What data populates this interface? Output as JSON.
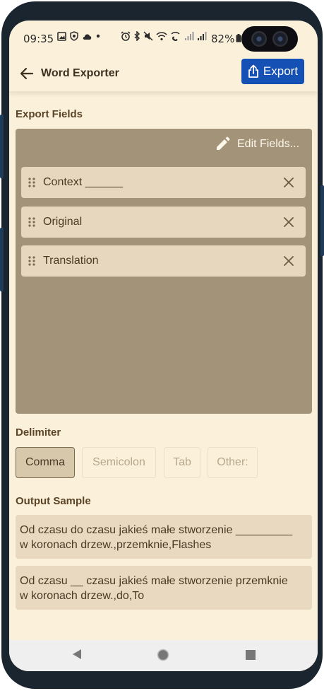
{
  "status_bar": {
    "time": "09:35",
    "battery": "82%"
  },
  "app_bar": {
    "title": "Word Exporter",
    "export_label": "Export"
  },
  "export_fields": {
    "section_label": "Export Fields",
    "edit_fields_label": "Edit Fields...",
    "items": [
      {
        "label": "Context ______"
      },
      {
        "label": "Original"
      },
      {
        "label": "Translation"
      }
    ]
  },
  "delimiter": {
    "section_label": "Delimiter",
    "options": [
      {
        "label": "Comma",
        "selected": true
      },
      {
        "label": "Semicolon",
        "selected": false
      },
      {
        "label": "Tab",
        "selected": false
      },
      {
        "label": "Other:",
        "selected": false
      }
    ]
  },
  "output_sample": {
    "section_label": "Output Sample",
    "rows": [
      "Od czasu do czasu jakieś małe stworzenie _________\nw koronach drzew.,przemknie,Flashes",
      "Od czasu __ czasu jakieś małe stworzenie przemknie\nw koronach drzew.,do,To"
    ]
  },
  "colors": {
    "background": "#fbf0d9",
    "accent": "#1550b5",
    "panel": "#a39378",
    "field_chip": "#e6d7be",
    "heading_text": "#5b4427"
  },
  "icons": {
    "back": "arrow-left-icon",
    "export": "share-upload-icon",
    "edit": "pencil-icon",
    "drag": "drag-handle-icon",
    "remove": "close-icon",
    "nav_back": "triangle-back-icon",
    "nav_home": "circle-home-icon",
    "nav_recents": "square-recents-icon"
  }
}
